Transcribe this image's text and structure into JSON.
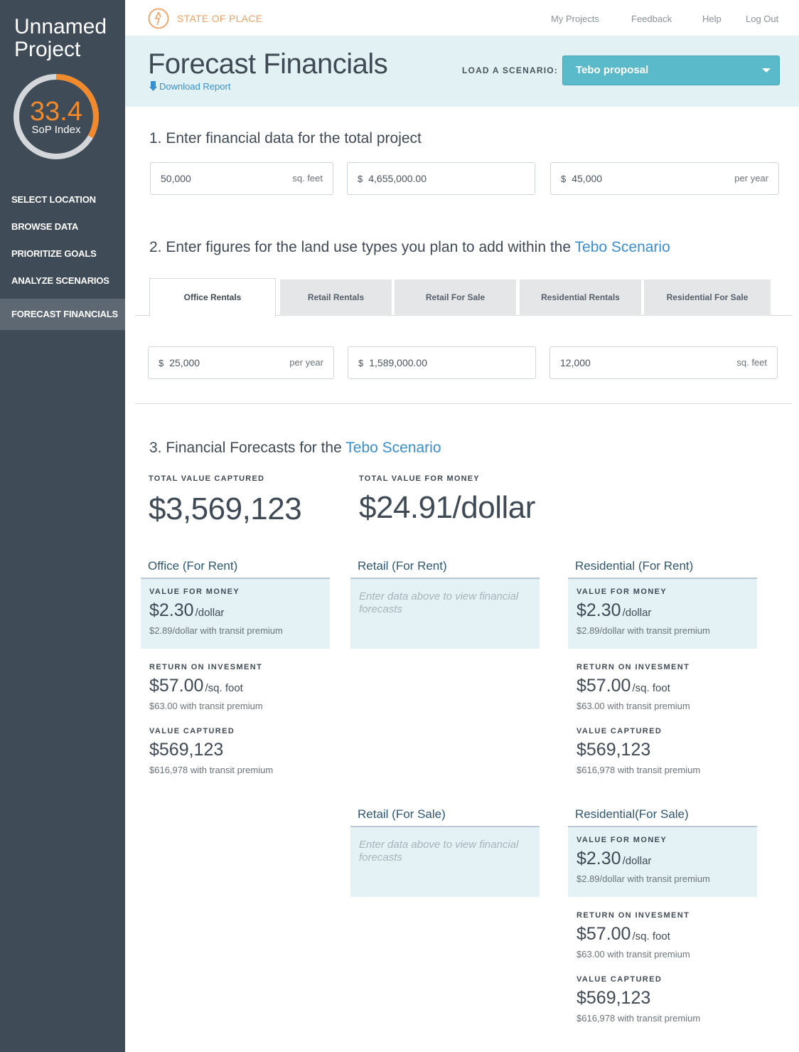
{
  "sidebar": {
    "project_name_line1": "Unnamed",
    "project_name_line2": "Project",
    "sop_value": "33.4",
    "sop_value_fraction": 0.334,
    "sop_label": "SoP Index",
    "items": [
      {
        "label": "SELECT LOCATION"
      },
      {
        "label": "BROWSE DATA"
      },
      {
        "label": "PRIORITIZE GOALS"
      },
      {
        "label": "ANALYZE SCENARIOS"
      },
      {
        "label": "FORECAST FINANCIALS"
      }
    ]
  },
  "topbar": {
    "brand": "STATE OF PLACE",
    "links": [
      "My Projects",
      "Feedback",
      "Help",
      "Log Out"
    ]
  },
  "header": {
    "title": "Forecast Financials",
    "download_label": "Download Report",
    "load_label": "LOAD A SCENARIO:",
    "scenario_selected": "Tebo proposal"
  },
  "section1": {
    "heading": "1. Enter financial data for the total project",
    "area_value": "50,000",
    "area_unit": "sq. feet",
    "cost_currency": "$",
    "cost_value": "4,655,000.00",
    "income_currency": "$",
    "income_value": "45,000",
    "income_unit": "per year"
  },
  "section2": {
    "heading_prefix": "2. Enter figures for the land use types you plan to add within the",
    "heading_accent": "Tebo Scenario",
    "tabs": [
      "Office Rentals",
      "Retail Rentals",
      "Retail For Sale",
      "Residential Rentals",
      "Residential For Sale"
    ],
    "rent_currency": "$",
    "rent_value": "25,000",
    "rent_unit": "per year",
    "cost_currency": "$",
    "cost_value": "1,589,000.00",
    "area_value": "12,000",
    "area_unit": "sq. feet"
  },
  "section3": {
    "heading_prefix": "3. Financial Forecasts for the",
    "heading_accent": "Tebo Scenario",
    "total_value_captured_label": "TOTAL VALUE CAPTURED",
    "total_value_captured": "$3,569,123",
    "total_value_money_label": "TOTAL VALUE FOR MONEY",
    "total_value_money": "$24.91/dollar",
    "empty_text": "Enter data above to view financial forecasts",
    "labels": {
      "vfm": "VALUE FOR MONEY",
      "roi": "RETURN ON INVESMENT",
      "vc": "VALUE CAPTURED"
    },
    "office_rent": {
      "title": "Office (For Rent)",
      "vfm_value": "$2.30",
      "vfm_unit": "/dollar",
      "vfm_sub": "$2.89/dollar  with transit premium",
      "roi_value": "$57.00",
      "roi_unit": "/sq. foot",
      "roi_sub": "$63.00 with transit premium",
      "vc_value": "$569,123",
      "vc_sub": "$616,978 with transit premium"
    },
    "retail_rent": {
      "title": "Retail (For Rent)"
    },
    "residential_rent": {
      "title": "Residential (For Rent)",
      "vfm_value": "$2.30",
      "vfm_unit": "/dollar",
      "vfm_sub": "$2.89/dollar  with transit premium",
      "roi_value": "$57.00",
      "roi_unit": "/sq. foot",
      "roi_sub": "$63.00 with transit premium",
      "vc_value": "$569,123",
      "vc_sub": "$616,978 with transit premium"
    },
    "retail_sale": {
      "title": "Retail (For Sale)"
    },
    "residential_sale": {
      "title": "Residential(For Sale)",
      "vfm_value": "$2.30",
      "vfm_unit": "/dollar",
      "vfm_sub": "$2.89/dollar  with transit premium",
      "roi_value": "$57.00",
      "roi_unit": "/sq. foot",
      "roi_sub": "$63.00 with transit premium",
      "vc_value": "$569,123",
      "vc_sub": "$616,978 with transit premium"
    }
  },
  "colors": {
    "sidebar_bg": "#3f4b57",
    "accent_orange": "#f08a2c",
    "accent_blue": "#3a8fd0",
    "select_teal": "#5bbac9",
    "card_bg": "#e4f2f5"
  }
}
